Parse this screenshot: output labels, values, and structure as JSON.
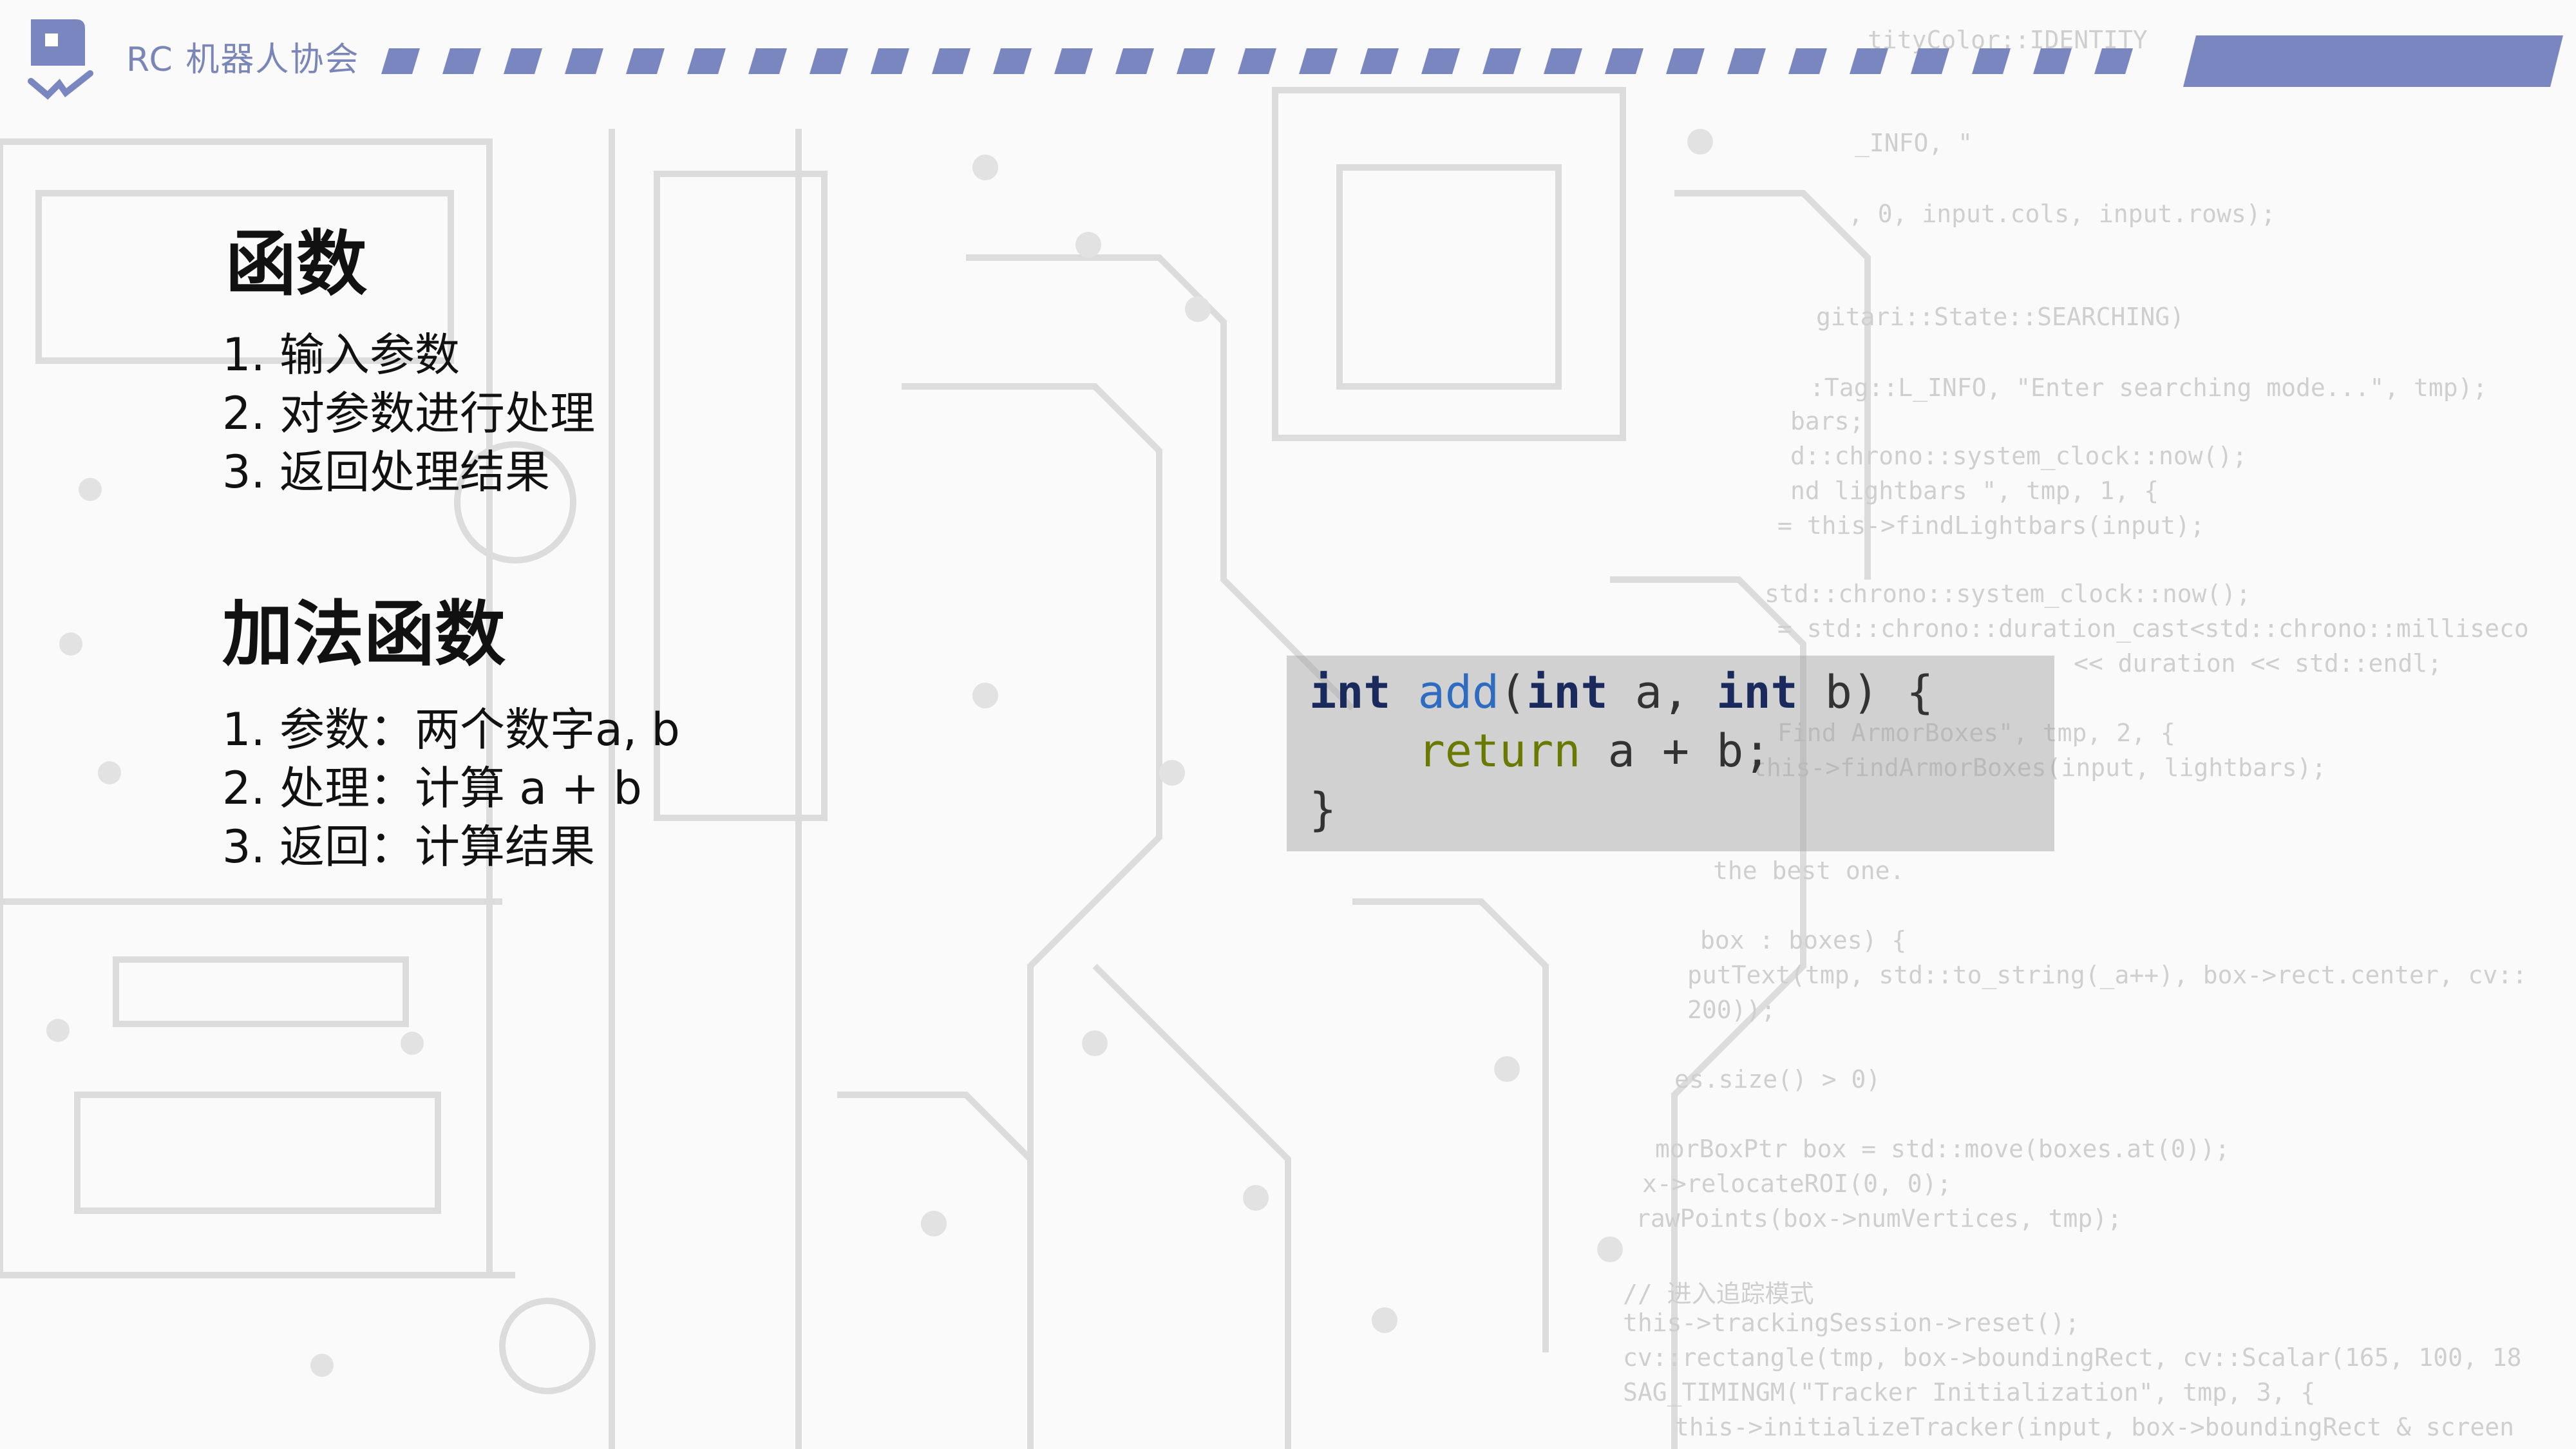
{
  "header": {
    "brand": "RC 机器人协会",
    "colors": {
      "accent": "#7a86c0",
      "logo": "#7a86c0"
    }
  },
  "section1": {
    "title": "函数",
    "items": [
      "1. 输入参数",
      "2. 对参数进行处理",
      "3. 返回处理结果"
    ]
  },
  "section2": {
    "title": "加法函数",
    "items": [
      "1. 参数：两个数字a, b",
      "2. 处理：计算 a + b",
      "3. 返回：计算结果"
    ]
  },
  "code": {
    "line1": {
      "kw1": "int",
      "fn": "add",
      "open": "(",
      "kw2": "int",
      "p1": " a, ",
      "kw3": "int",
      "p2": " b) {"
    },
    "line2": {
      "indent": "    ",
      "kw": "return",
      "rest": " a + b;"
    },
    "line3": "}"
  },
  "background_code": [
    "tityColor::IDENTITY",
    "_INFO, \"",
    ", 0, input.cols, input.rows);",
    "gitari::State::SEARCHING)",
    ":Tag::L_INFO, \"Enter searching mode...\", tmp);",
    "bars;",
    "d::chrono::system_clock::now();",
    "nd lightbars \", tmp, 1, {",
    "= this->findLightbars(input);",
    "std::chrono::system_clock::now();",
    "= std::chrono::duration_cast<std::chrono::milliseco",
    "<< duration << std::endl;",
    "Find ArmorBoxes\", tmp, 2, {",
    "this->findArmorBoxes(input, lightbars);",
    "the best one.",
    "box : boxes) {",
    "putText(tmp, std::to_string(_a++), box->rect.center, cv::",
    "200));",
    "es.size() > 0)",
    "morBoxPtr box = std::move(boxes.at(0));",
    "x->relocateROI(0, 0);",
    "rawPoints(box->numVertices, tmp);",
    "// 进入追踪模式",
    "this->trackingSession->reset();",
    "cv::rectangle(tmp, box->boundingRect, cv::Scalar(165, 100, 18",
    "SAG_TIMINGM(\"Tracker Initialization\", tmp, 3, {",
    "this->initializeTracker(input, box->boundingRect & screen"
  ]
}
